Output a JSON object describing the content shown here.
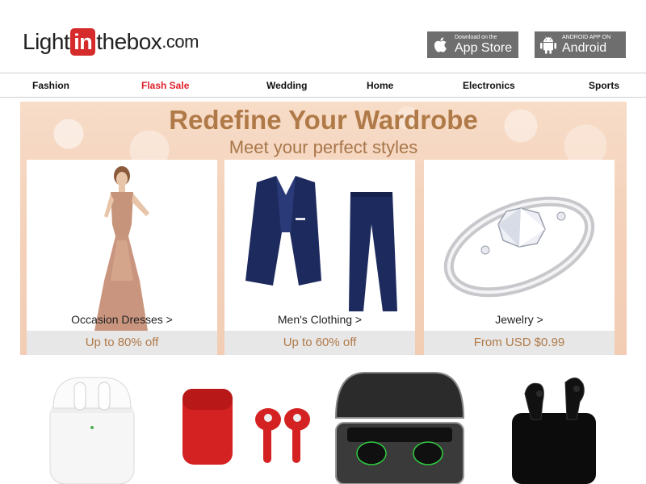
{
  "header": {
    "logo": {
      "light": "Light",
      "in": "in",
      "thebox": "thebox",
      "dotcom": ".com"
    },
    "app_store": {
      "small": "Download on the",
      "big": "App Store",
      "icon": "apple-icon"
    },
    "android": {
      "small": "ANDROID APP ON",
      "big": "Android",
      "icon": "android-icon"
    }
  },
  "nav": {
    "items": [
      {
        "label": "Fashion"
      },
      {
        "label": "Flash Sale"
      },
      {
        "label": "Wedding"
      },
      {
        "label": "Home"
      },
      {
        "label": "Electronics"
      },
      {
        "label": "Sports"
      }
    ]
  },
  "hero": {
    "title": "Redefine Your Wardrobe",
    "subtitle": "Meet your perfect styles",
    "cards": [
      {
        "label": "Occasion Dresses >",
        "promo": "Up to 80% off"
      },
      {
        "label": "Men's Clothing >",
        "promo": "Up to 60% off"
      },
      {
        "label": "Jewelry >",
        "promo": "From USD $0.99"
      }
    ]
  },
  "colors": {
    "accent": "#e0202a",
    "gold": "#b07a48",
    "store_button": "#6e6e6e"
  }
}
